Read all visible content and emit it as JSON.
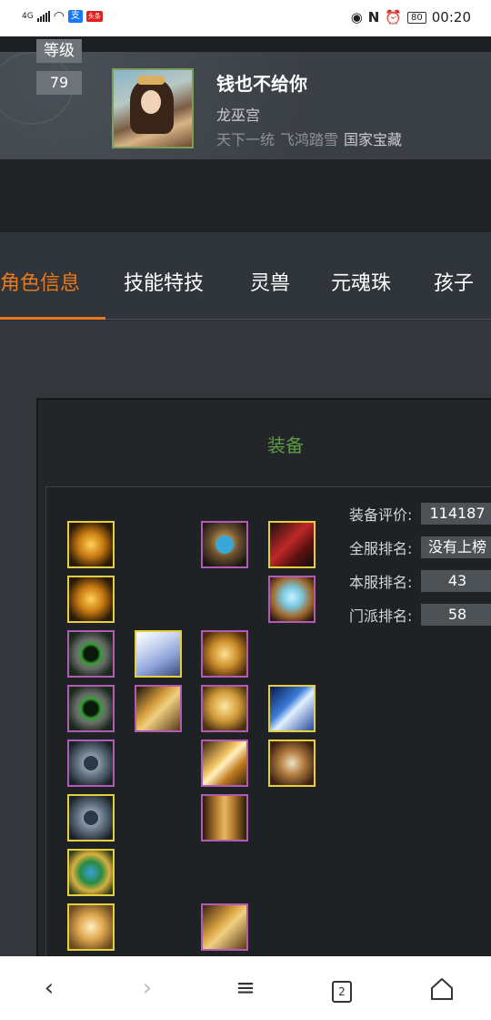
{
  "status_bar": {
    "network": "4G",
    "alipay_label": "支",
    "toutiao_label": "头条",
    "battery": "80",
    "time": "00:20"
  },
  "profile": {
    "level_label": "等级",
    "level_value": "79",
    "name": "钱也不给你",
    "sect": "龙巫宫",
    "titles": [
      "天下一统",
      "飞鸿踏雪",
      "国家宝藏"
    ]
  },
  "tabs": [
    {
      "label": "角色信息",
      "active": true
    },
    {
      "label": "技能特技",
      "active": false
    },
    {
      "label": "灵兽",
      "active": false
    },
    {
      "label": "元魂珠",
      "active": false
    },
    {
      "label": "孩子",
      "active": false
    }
  ],
  "equipment": {
    "title": "装备",
    "stats": [
      {
        "label": "装备评价:",
        "value": "114187"
      },
      {
        "label": "全服排名:",
        "value": "没有上榜"
      },
      {
        "label": "本服排名:",
        "value": "43"
      },
      {
        "label": "门派排名:",
        "value": "58"
      }
    ]
  },
  "nav": {
    "back_icon": "chevron-left",
    "forward_icon": "chevron-right",
    "menu_icon": "hamburger",
    "tabs_count": "2",
    "home_icon": "home"
  }
}
